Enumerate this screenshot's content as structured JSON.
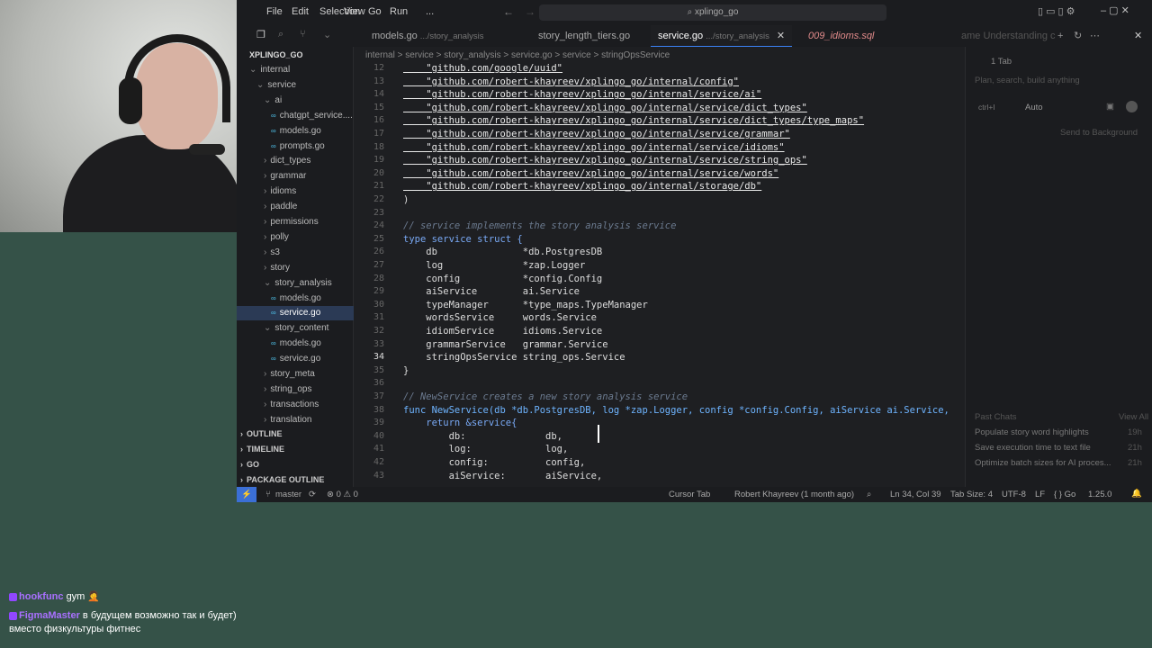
{
  "menu": [
    "File",
    "Edit",
    "Selection",
    "View",
    "Go",
    "Run",
    "..."
  ],
  "search": "xplingo_go",
  "tabs": [
    {
      "label": "models.go",
      "sub": ".../story_analysis"
    },
    {
      "label": "story_length_tiers.go",
      "sub": ""
    },
    {
      "label": "service.go",
      "sub": ".../story_analysis"
    },
    {
      "label": "009_idioms.sql",
      "sub": ""
    }
  ],
  "chat_tabs": "ame   Understanding c",
  "project": "XPLINGO_GO",
  "tree": [
    {
      "label": "internal",
      "indent": 0,
      "sel": false
    },
    {
      "label": "service",
      "indent": 1,
      "sel": false
    },
    {
      "label": "ai",
      "indent": 2,
      "sel": false
    },
    {
      "label": "chatgpt_service....",
      "indent": 3,
      "sel": false
    },
    {
      "label": "models.go",
      "indent": 3,
      "sel": false
    },
    {
      "label": "prompts.go",
      "indent": 3,
      "sel": false
    },
    {
      "label": "dict_types",
      "indent": 2,
      "sel": false
    },
    {
      "label": "grammar",
      "indent": 2,
      "sel": false
    },
    {
      "label": "idioms",
      "indent": 2,
      "sel": false
    },
    {
      "label": "paddle",
      "indent": 2,
      "sel": false
    },
    {
      "label": "permissions",
      "indent": 2,
      "sel": false
    },
    {
      "label": "polly",
      "indent": 2,
      "sel": false
    },
    {
      "label": "s3",
      "indent": 2,
      "sel": false
    },
    {
      "label": "story",
      "indent": 2,
      "sel": false
    },
    {
      "label": "story_analysis",
      "indent": 2,
      "sel": false
    },
    {
      "label": "models.go",
      "indent": 3,
      "sel": false
    },
    {
      "label": "service.go",
      "indent": 3,
      "sel": true
    },
    {
      "label": "story_content",
      "indent": 2,
      "sel": false
    },
    {
      "label": "models.go",
      "indent": 3,
      "sel": false
    },
    {
      "label": "service.go",
      "indent": 3,
      "sel": false
    },
    {
      "label": "story_meta",
      "indent": 2,
      "sel": false
    },
    {
      "label": "string_ops",
      "indent": 2,
      "sel": false
    },
    {
      "label": "transactions",
      "indent": 2,
      "sel": false
    },
    {
      "label": "translation",
      "indent": 2,
      "sel": false
    }
  ],
  "sections": [
    "OUTLINE",
    "TIMELINE",
    "GO",
    "PACKAGE OUTLINE"
  ],
  "breadcrumb": "internal  >  service  >  story_analysis  >  service.go  >  service  >  stringOpsService",
  "code": [
    {
      "n": "12",
      "t": "    \"github.com/google/uuid\"",
      "c": "str"
    },
    {
      "n": "13",
      "t": "    \"github.com/robert-khayreev/xplingo_go/internal/config\"",
      "c": "str"
    },
    {
      "n": "14",
      "t": "    \"github.com/robert-khayreev/xplingo_go/internal/service/ai\"",
      "c": "str"
    },
    {
      "n": "15",
      "t": "    \"github.com/robert-khayreev/xplingo_go/internal/service/dict_types\"",
      "c": "str"
    },
    {
      "n": "16",
      "t": "    \"github.com/robert-khayreev/xplingo_go/internal/service/dict_types/type_maps\"",
      "c": "str"
    },
    {
      "n": "17",
      "t": "    \"github.com/robert-khayreev/xplingo_go/internal/service/grammar\"",
      "c": "str"
    },
    {
      "n": "18",
      "t": "    \"github.com/robert-khayreev/xplingo_go/internal/service/idioms\"",
      "c": "str"
    },
    {
      "n": "19",
      "t": "    \"github.com/robert-khayreev/xplingo_go/internal/service/string_ops\"",
      "c": "str"
    },
    {
      "n": "20",
      "t": "    \"github.com/robert-khayreev/xplingo_go/internal/service/words\"",
      "c": "str"
    },
    {
      "n": "21",
      "t": "    \"github.com/robert-khayreev/xplingo_go/internal/storage/db\"",
      "c": "str"
    },
    {
      "n": "22",
      "t": ")",
      "c": ""
    },
    {
      "n": "23",
      "t": "",
      "c": ""
    },
    {
      "n": "24",
      "t": "// service implements the story analysis service",
      "c": "cm"
    },
    {
      "n": "25",
      "t": "type service struct {",
      "c": "kw"
    },
    {
      "n": "26",
      "t": "    db               *db.PostgresDB",
      "c": ""
    },
    {
      "n": "27",
      "t": "    log              *zap.Logger",
      "c": ""
    },
    {
      "n": "28",
      "t": "    config           *config.Config",
      "c": ""
    },
    {
      "n": "29",
      "t": "    aiService        ai.Service",
      "c": ""
    },
    {
      "n": "30",
      "t": "    typeManager      *type_maps.TypeManager",
      "c": ""
    },
    {
      "n": "31",
      "t": "    wordsService     words.Service",
      "c": ""
    },
    {
      "n": "32",
      "t": "    idiomService     idioms.Service",
      "c": ""
    },
    {
      "n": "33",
      "t": "    grammarService   grammar.Service",
      "c": ""
    },
    {
      "n": "34",
      "t": "    stringOpsService string_ops.Service",
      "c": ""
    },
    {
      "n": "35",
      "t": "}",
      "c": ""
    },
    {
      "n": "36",
      "t": "",
      "c": ""
    },
    {
      "n": "37",
      "t": "// NewService creates a new story analysis service",
      "c": "cm"
    },
    {
      "n": "38",
      "t": "func NewService(db *db.PostgresDB, log *zap.Logger, config *config.Config, aiService ai.Service,",
      "c": "fn"
    },
    {
      "n": "39",
      "t": "    return &service{",
      "c": "kw"
    },
    {
      "n": "40",
      "t": "        db:              db,",
      "c": ""
    },
    {
      "n": "41",
      "t": "        log:             log,",
      "c": ""
    },
    {
      "n": "42",
      "t": "        config:          config,",
      "c": ""
    },
    {
      "n": "43",
      "t": "        aiService:       aiService,",
      "c": ""
    }
  ],
  "chat": {
    "tab_count": "1 Tab",
    "placeholder": "Plan, search, build anything",
    "mode": "ctrl+I",
    "model": "Auto",
    "send_bg": "Send to Background",
    "past": "Past Chats",
    "view_all": "View All",
    "items": [
      {
        "title": "Populate story word highlights",
        "time": "19h"
      },
      {
        "title": "Save execution time to text file",
        "time": "21h"
      },
      {
        "title": "Optimize batch sizes for AI proces...",
        "time": "21h"
      }
    ]
  },
  "status": {
    "branch": "master",
    "problems": "⊗ 0 ⚠ 0",
    "cursor_tab": "Cursor Tab",
    "blame": "Robert Khayreev (1 month ago)",
    "pos": "Ln 34, Col 39",
    "tab": "Tab Size: 4",
    "enc": "UTF-8",
    "eol": "LF",
    "lang": "{ } Go",
    "ver": "1.25.0"
  },
  "stream_chat": [
    {
      "user": "hookfunc",
      "msg": "gym 🤦"
    },
    {
      "user": "FigmaMaster",
      "msg": "в будущем возможно так и будет) вместо физкультуры фитнес"
    }
  ]
}
